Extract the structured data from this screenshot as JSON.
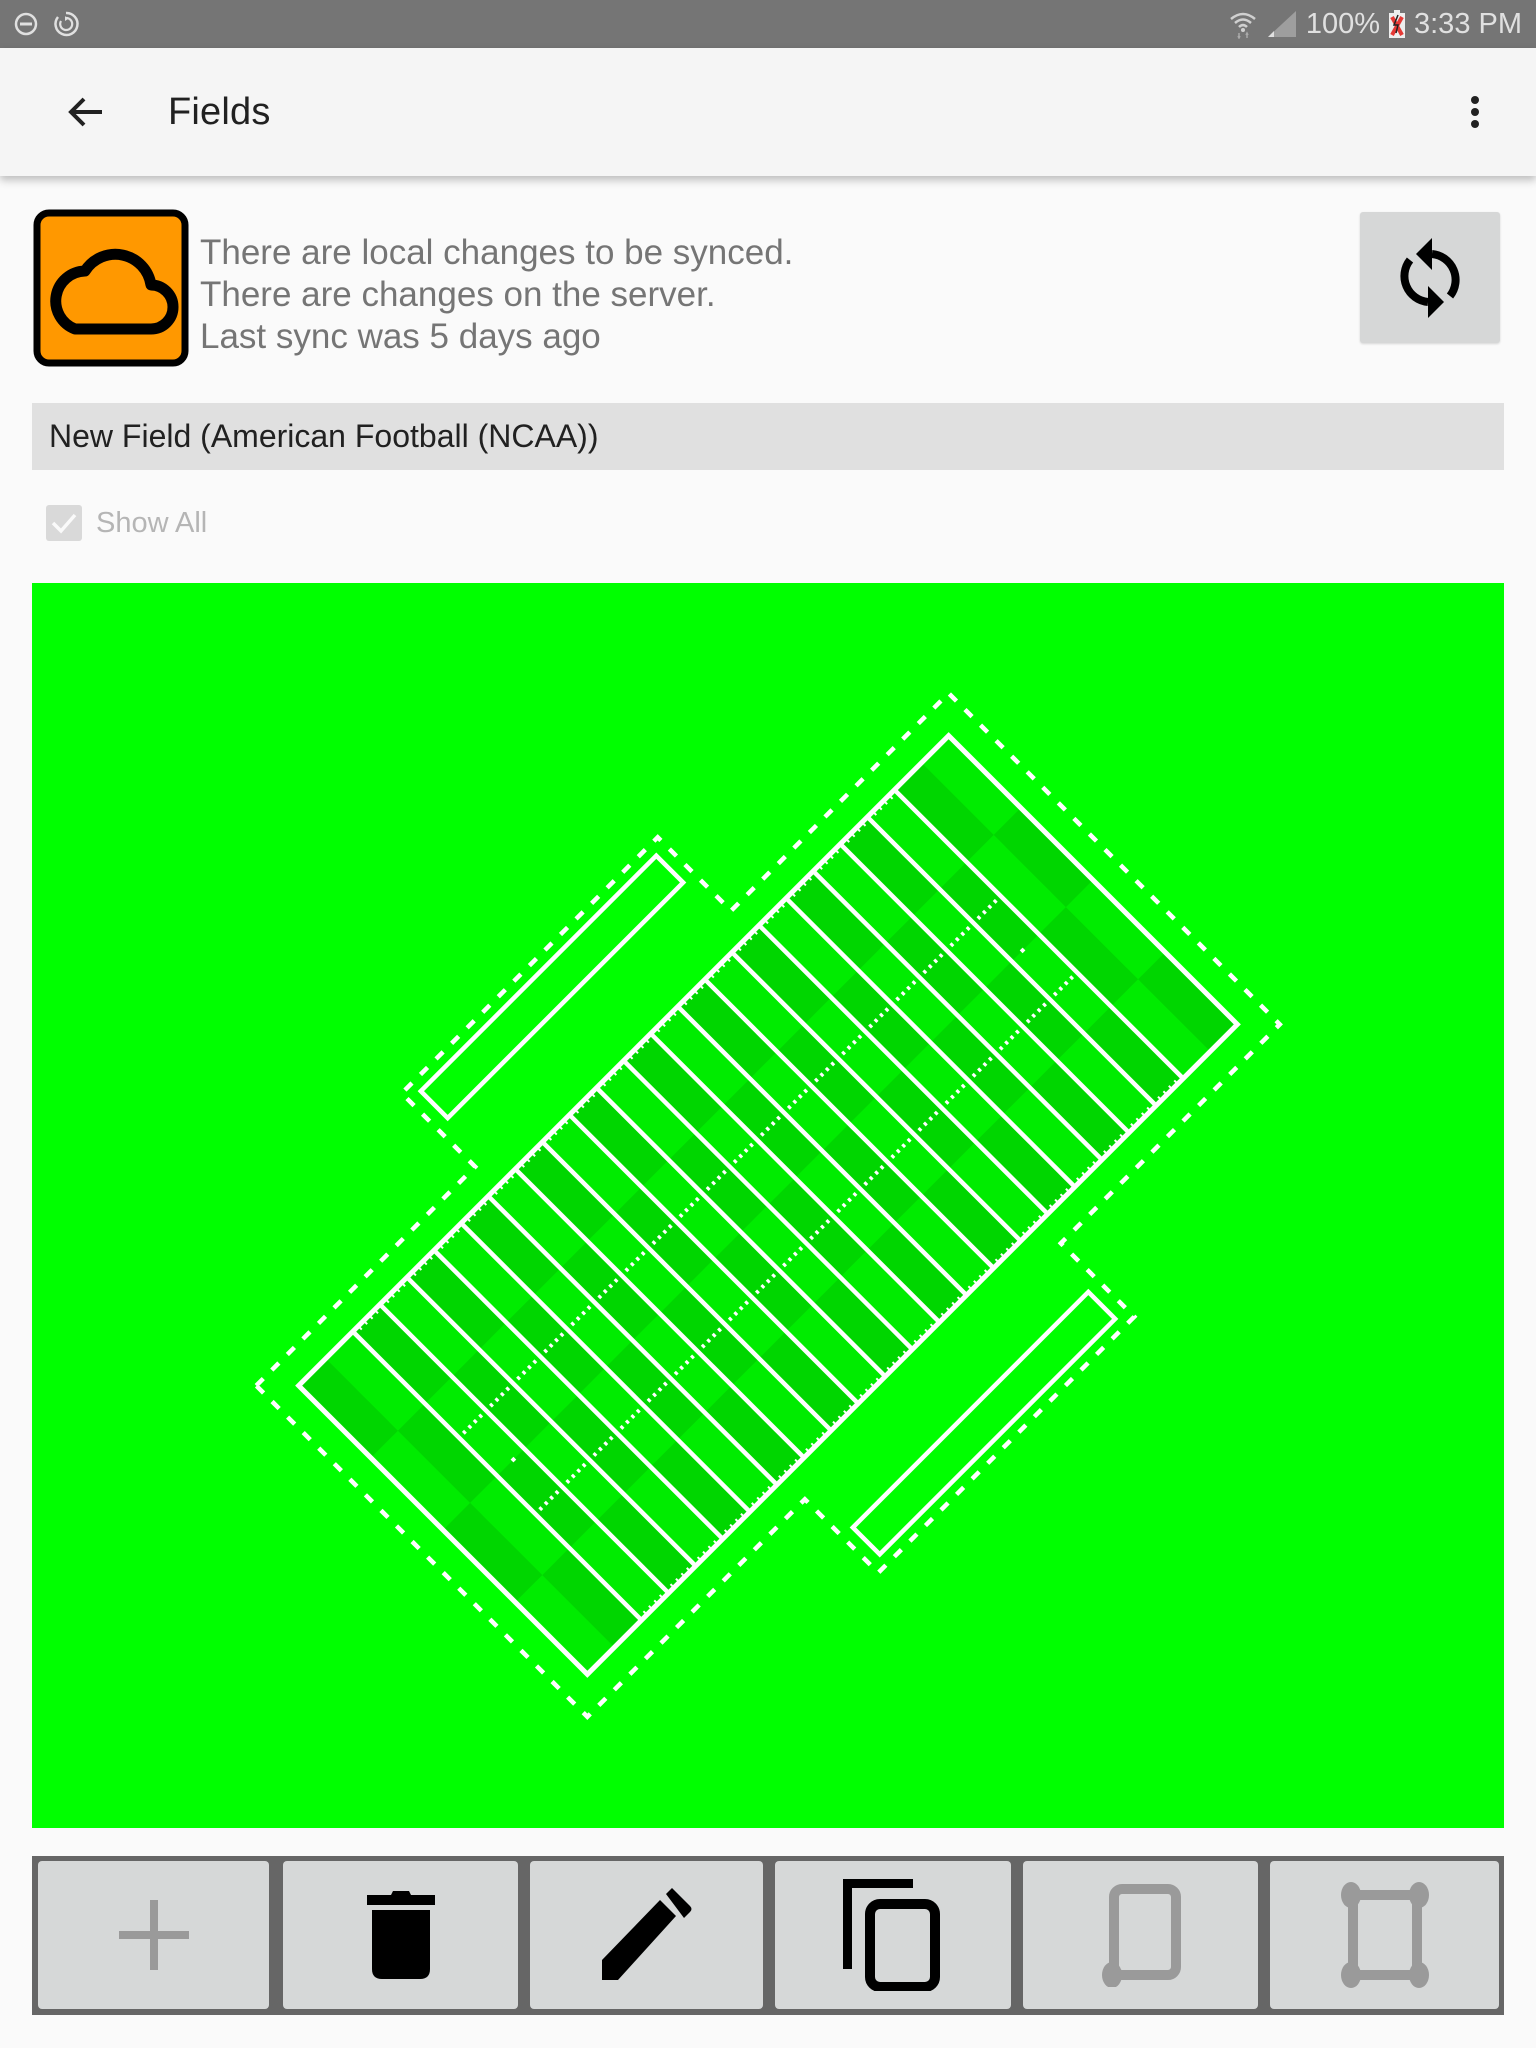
{
  "status_bar": {
    "left_icons": [
      "do-not-disturb-icon",
      "sync-circle-icon"
    ],
    "right_icons": [
      "wifi-icon",
      "cell-signal-icon",
      "battery-charging-icon"
    ],
    "battery": "100%",
    "time": "3:33 PM"
  },
  "app_bar": {
    "title": "Fields",
    "back_icon": "arrow-back-icon",
    "menu_icon": "more-vert-icon"
  },
  "sync": {
    "status_icon": "cloud-icon",
    "status_color": "#FF9800",
    "lines": [
      "There are local changes to be synced.",
      "There are changes on the server.",
      "Last sync was 5 days ago"
    ],
    "sync_button_icon": "sync-icon"
  },
  "field_selector": {
    "selected": "New Field (American Football (NCAA))"
  },
  "show_all": {
    "label": "Show All",
    "checked": true,
    "enabled": false
  },
  "map": {
    "background_color": "#00FF00",
    "field": {
      "sport": "American Football (NCAA)",
      "length_yards": 120,
      "width_yards": 53.3,
      "endzone_yards": 10,
      "yard_line_interval": 5,
      "rotation_deg": -45,
      "team_areas": 2,
      "stripe_dark": "#00D600",
      "stripe_light": "#00EC00",
      "line_color": "#FFFFFF"
    }
  },
  "toolbar": {
    "buttons": [
      {
        "name": "add",
        "icon": "add-icon",
        "enabled": false
      },
      {
        "name": "delete",
        "icon": "delete-icon",
        "enabled": true
      },
      {
        "name": "edit",
        "icon": "edit-icon",
        "enabled": true
      },
      {
        "name": "copy",
        "icon": "copy-icon",
        "enabled": true
      },
      {
        "name": "edit-corner",
        "icon": "corner-edit-icon",
        "enabled": false
      },
      {
        "name": "edit-corners",
        "icon": "corners-edit-icon",
        "enabled": false
      }
    ]
  }
}
